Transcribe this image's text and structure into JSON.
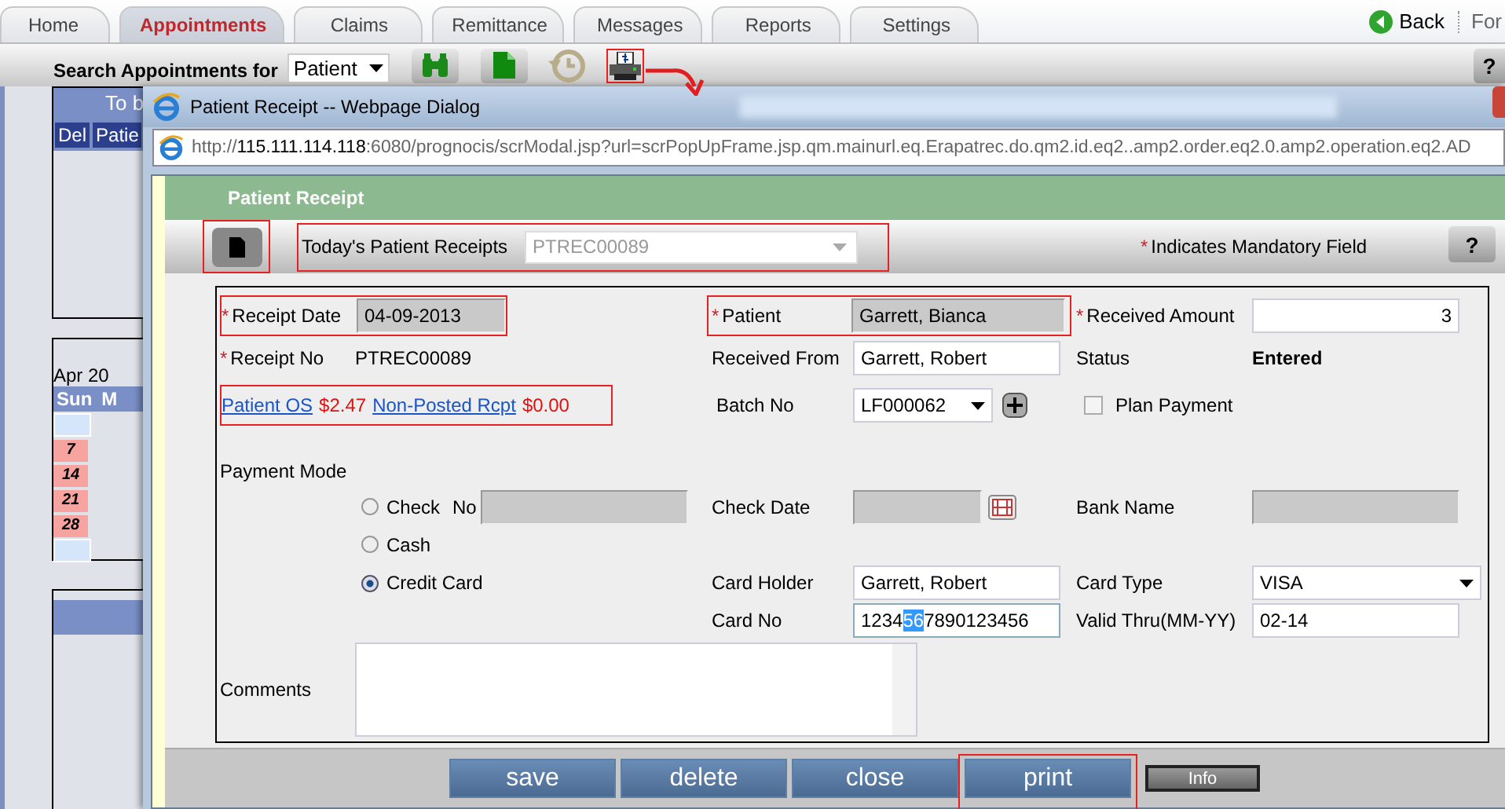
{
  "app_tabs": [
    {
      "label": "Home",
      "selected": false
    },
    {
      "label": "Appointments",
      "selected": true
    },
    {
      "label": "Claims",
      "selected": false
    },
    {
      "label": "Remittance",
      "selected": false
    },
    {
      "label": "Messages",
      "selected": false
    },
    {
      "label": "Reports",
      "selected": false
    },
    {
      "label": "Settings",
      "selected": false
    }
  ],
  "nav": {
    "back": "Back",
    "forward": "For"
  },
  "toolbar": {
    "search_label": "Search Appointments for",
    "search_by": "Patient",
    "help": "?",
    "print_highlighted": true
  },
  "left_panels": {
    "list_title": "To b",
    "columns": [
      "Del",
      "Patie"
    ],
    "month": "Apr 20",
    "weekdays": [
      "Sun",
      "M"
    ],
    "days": [
      "7",
      "14",
      "21",
      "28"
    ]
  },
  "dialog": {
    "title": "Patient Receipt -- Webpage Dialog",
    "url_scheme": "http://",
    "url_host": "115.111.114.118",
    "url_path": ":6080/prognocis/scrModal.jsp?url=scrPopUpFrame.jsp.qm.mainurl.eq.Erapatrec.do.qm2.id.eq2..amp2.order.eq2.0.amp2.operation.eq2.AD"
  },
  "header": "Patient Receipt",
  "receipt_bar": {
    "label": "Today's Patient Receipts",
    "value": "PTREC00089",
    "mark": "*",
    "note": "Indicates Mandatory Field",
    "help": "?"
  },
  "form": {
    "receipt_date": {
      "label": "Receipt Date",
      "value": "04-09-2013",
      "required": true,
      "disabled": true
    },
    "patient": {
      "label": "Patient",
      "value": "Garrett, Bianca",
      "required": true,
      "disabled": true
    },
    "received_amount": {
      "label": "Received Amount",
      "value": "3",
      "required": true
    },
    "receipt_no": {
      "label": "Receipt No",
      "value": "PTREC00089",
      "required": true
    },
    "received_from": {
      "label": "Received From",
      "value": "Garrett, Robert"
    },
    "status": {
      "label": "Status",
      "value": "Entered"
    },
    "balances": {
      "patient_os": "Patient OS",
      "patient_os_amount": "$2.47",
      "non_posted": "Non-Posted Rcpt",
      "non_posted_amount": "$0.00"
    },
    "batch_no": {
      "label": "Batch No",
      "value": "LF000062"
    },
    "plan_payment": {
      "label": "Plan Payment",
      "checked": false
    },
    "payment_mode": "Payment Mode",
    "modes": [
      {
        "label": "Check",
        "selected": false
      },
      {
        "label": "Cash",
        "selected": false
      },
      {
        "label": "Credit Card",
        "selected": true
      }
    ],
    "check_no": {
      "label": "No",
      "disabled": true
    },
    "check_date": {
      "label": "Check Date",
      "disabled": true
    },
    "bank_name": {
      "label": "Bank Name",
      "disabled": true
    },
    "card_holder": {
      "label": "Card Holder",
      "value": "Garrett, Robert"
    },
    "card_type": {
      "label": "Card Type",
      "value": "VISA"
    },
    "card_no": {
      "label": "Card No",
      "value_parts": [
        "1234",
        "56",
        "7890123456"
      ]
    },
    "valid_thru": {
      "label": "Valid Thru(MM-YY)",
      "value": "02-14"
    },
    "comments": {
      "label": "Comments"
    }
  },
  "actions": [
    {
      "label": "save",
      "highlighted": false
    },
    {
      "label": "delete",
      "highlighted": false
    },
    {
      "label": "close",
      "highlighted": false
    },
    {
      "label": "print",
      "highlighted": true
    }
  ],
  "info": "Info"
}
